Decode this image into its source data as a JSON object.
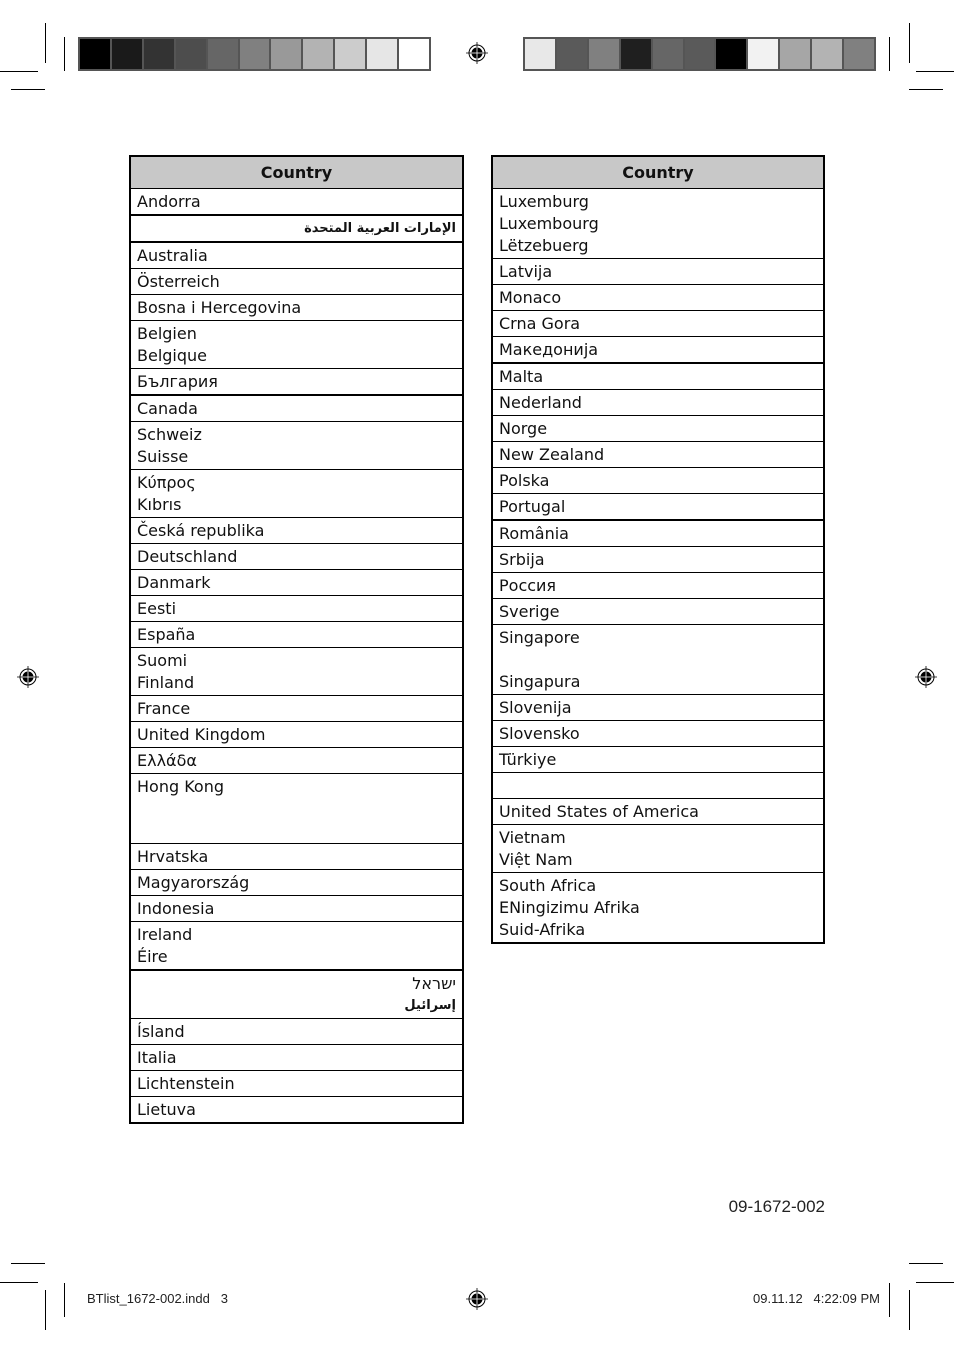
{
  "colorbar_left": [
    "#000000",
    "#1a1a1a",
    "#333333",
    "#4d4d4d",
    "#666666",
    "#808080",
    "#999999",
    "#b3b3b3",
    "#cccccc",
    "#e6e6e6",
    "#ffffff"
  ],
  "colorbar_right": [
    "#e8e8e8",
    "#5a5a5a",
    "#808080",
    "#1f1f1f",
    "#666666",
    "#5a5a5a",
    "#000000",
    "#f2f2f2",
    "#a6a6a6",
    "#b3b3b3",
    "#808080"
  ],
  "left_table": {
    "header": "Country",
    "rows": [
      {
        "lines": [
          "Andorra"
        ]
      },
      {
        "lines": [
          "الإمارات العربية المتحدة"
        ],
        "rtl": true,
        "thick": true
      },
      {
        "lines": [
          "Australia"
        ],
        "thick": true
      },
      {
        "lines": [
          "Österreich"
        ]
      },
      {
        "lines": [
          "Bosna i Hercegovina"
        ]
      },
      {
        "lines": [
          "Belgien",
          "Belgique"
        ]
      },
      {
        "lines": [
          "България"
        ]
      },
      {
        "lines": [
          "Canada"
        ],
        "thick": true
      },
      {
        "lines": [
          "Schweiz",
          "Suisse"
        ]
      },
      {
        "lines": [
          "Κύπρος",
          "Kıbrıs"
        ]
      },
      {
        "lines": [
          "Česká republika"
        ]
      },
      {
        "lines": [
          "Deutschland"
        ]
      },
      {
        "lines": [
          "Danmark"
        ]
      },
      {
        "lines": [
          "Eesti"
        ]
      },
      {
        "lines": [
          "España"
        ]
      },
      {
        "lines": [
          "Suomi",
          "Finland"
        ]
      },
      {
        "lines": [
          "France"
        ]
      },
      {
        "lines": [
          "United Kingdom"
        ]
      },
      {
        "lines": [
          "Ελλάδα"
        ]
      },
      {
        "lines": [
          "Hong Kong",
          "",
          ""
        ]
      },
      {
        "lines": [
          "Hrvatska"
        ]
      },
      {
        "lines": [
          "Magyarország"
        ]
      },
      {
        "lines": [
          "Indonesia"
        ]
      },
      {
        "lines": [
          "Ireland",
          "Éire"
        ]
      },
      {
        "lines": [
          "ישראל",
          "إسرائيل"
        ],
        "rtl": true,
        "thick": true
      },
      {
        "lines": [
          "Ísland"
        ]
      },
      {
        "lines": [
          "Italia"
        ]
      },
      {
        "lines": [
          "Lichtenstein"
        ]
      },
      {
        "lines": [
          "Lietuva"
        ]
      }
    ]
  },
  "right_table": {
    "header": "Country",
    "rows": [
      {
        "lines": [
          "Luxemburg",
          "Luxembourg",
          "Lëtzebuerg"
        ]
      },
      {
        "lines": [
          "Latvija"
        ]
      },
      {
        "lines": [
          "Monaco"
        ]
      },
      {
        "lines": [
          "Crna Gora"
        ]
      },
      {
        "lines": [
          "Македонија"
        ]
      },
      {
        "lines": [
          "Malta"
        ],
        "thick": true
      },
      {
        "lines": [
          "Nederland"
        ]
      },
      {
        "lines": [
          "Norge"
        ]
      },
      {
        "lines": [
          "New Zealand"
        ]
      },
      {
        "lines": [
          "Polska"
        ]
      },
      {
        "lines": [
          "Portugal"
        ]
      },
      {
        "lines": [
          "România"
        ],
        "thick": true
      },
      {
        "lines": [
          "Srbija"
        ]
      },
      {
        "lines": [
          "Россия"
        ]
      },
      {
        "lines": [
          "Sverige"
        ]
      },
      {
        "lines": [
          "Singapore",
          "",
          "Singapura"
        ]
      },
      {
        "lines": [
          "Slovenija"
        ]
      },
      {
        "lines": [
          "Slovensko"
        ]
      },
      {
        "lines": [
          "Türkiye"
        ]
      },
      {
        "lines": [
          ""
        ]
      },
      {
        "lines": [
          "United States of America"
        ]
      },
      {
        "lines": [
          "Vietnam",
          "Việt Nam"
        ]
      },
      {
        "lines": [
          "South Africa",
          "ENingizimu Afrika",
          "Suid-Afrika"
        ]
      }
    ]
  },
  "document_code": "09-1672-002",
  "footer": {
    "file_name": "BTlist_1672-002.indd   3",
    "timestamp": "09.11.12   4:22:09 PM"
  },
  "icons": {
    "registration_mark": "registration-target"
  }
}
